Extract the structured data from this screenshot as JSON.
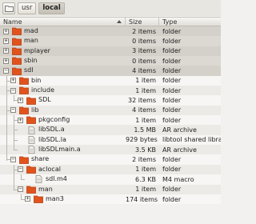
{
  "pathbar": {
    "crumbs": [
      {
        "label": "usr",
        "active": false
      },
      {
        "label": "local",
        "active": true
      }
    ]
  },
  "columns": {
    "name": "Name",
    "size": "Size",
    "type": "Type"
  },
  "rows": [
    {
      "name": "mad",
      "size": "2 items",
      "type": "folder",
      "depth": 0,
      "kind": "folder",
      "expander": "+"
    },
    {
      "name": "man",
      "size": "0 items",
      "type": "folder",
      "depth": 0,
      "kind": "folder",
      "expander": "+"
    },
    {
      "name": "mplayer",
      "size": "3 items",
      "type": "folder",
      "depth": 0,
      "kind": "folder",
      "expander": "+"
    },
    {
      "name": "sbin",
      "size": "0 items",
      "type": "folder",
      "depth": 0,
      "kind": "folder",
      "expander": "+"
    },
    {
      "name": "sdl",
      "size": "4 items",
      "type": "folder",
      "depth": 0,
      "kind": "folder",
      "expander": "-"
    },
    {
      "name": "bin",
      "size": "1 item",
      "type": "folder",
      "depth": 1,
      "kind": "folder",
      "expander": "+"
    },
    {
      "name": "include",
      "size": "1 item",
      "type": "folder",
      "depth": 1,
      "kind": "folder",
      "expander": "-"
    },
    {
      "name": "SDL",
      "size": "32 items",
      "type": "folder",
      "depth": 2,
      "kind": "folder",
      "expander": "+"
    },
    {
      "name": "lib",
      "size": "4 items",
      "type": "folder",
      "depth": 1,
      "kind": "folder",
      "expander": "-"
    },
    {
      "name": "pkgconfig",
      "size": "1 item",
      "type": "folder",
      "depth": 2,
      "kind": "folder",
      "expander": "+"
    },
    {
      "name": "libSDL.a",
      "size": "1.5 MB",
      "type": "AR archive",
      "depth": 2,
      "kind": "file",
      "expander": ""
    },
    {
      "name": "libSDL.la",
      "size": "929 bytes",
      "type": "libtool shared library",
      "depth": 2,
      "kind": "file",
      "expander": ""
    },
    {
      "name": "libSDLmain.a",
      "size": "3.5 KB",
      "type": "AR archive",
      "depth": 2,
      "kind": "file",
      "expander": ""
    },
    {
      "name": "share",
      "size": "2 items",
      "type": "folder",
      "depth": 1,
      "kind": "folder",
      "expander": "-"
    },
    {
      "name": "aclocal",
      "size": "1 item",
      "type": "folder",
      "depth": 2,
      "kind": "folder",
      "expander": "-"
    },
    {
      "name": "sdl.m4",
      "size": "6.3 KB",
      "type": "M4 macro",
      "depth": 3,
      "kind": "file",
      "expander": ""
    },
    {
      "name": "man",
      "size": "1 item",
      "type": "folder",
      "depth": 2,
      "kind": "folder",
      "expander": "-"
    },
    {
      "name": "man3",
      "size": "174 items",
      "type": "folder",
      "depth": 3,
      "kind": "folder",
      "expander": "+"
    }
  ],
  "colors": {
    "folder": "#e0541c",
    "folder_dark": "#b53d10",
    "file": "#b8b4ab"
  }
}
